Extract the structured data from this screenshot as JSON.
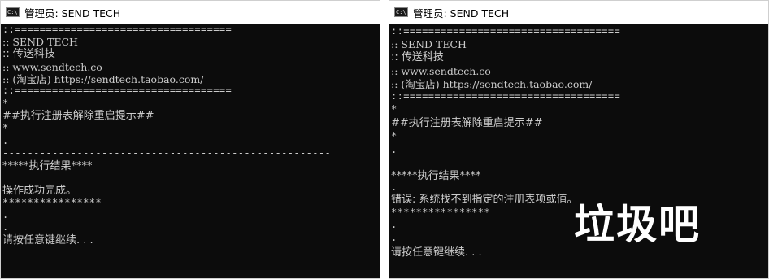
{
  "left_window": {
    "title": "管理员: SEND TECH",
    "lines": [
      "::===================================",
      ":: SEND TECH",
      ":: 传送科技",
      ":: www.sendtech.co",
      ":: (淘宝店) https://sendtech.taobao.com/",
      "::===================================",
      "*",
      "##执行注册表解除重启提示##",
      "*",
      ".",
      "-----------------------------------------------------",
      "*****执行结果****",
      "",
      "操作成功完成。",
      "****************",
      ".",
      ".",
      "请按任意键继续. . ."
    ]
  },
  "right_window": {
    "title": "管理员: SEND TECH",
    "lines": [
      "::===================================",
      ":: SEND TECH",
      ":: 传送科技",
      ":: www.sendtech.co",
      ":: (淘宝店) https://sendtech.taobao.com/",
      "::===================================",
      "*",
      "##执行注册表解除重启提示##",
      "*",
      ".",
      "-----------------------------------------------------",
      "*****执行结果****",
      ".",
      "错误: 系统找不到指定的注册表项或值。",
      "****************",
      ".",
      ".",
      "请按任意键继续. . ."
    ]
  },
  "watermark": "垃圾吧",
  "icons": {
    "title_icon": "cmd-console-icon"
  },
  "colors": {
    "console_bg": "#0c0c0c",
    "console_text": "#cccccc",
    "titlebar_bg": "#ffffff"
  }
}
